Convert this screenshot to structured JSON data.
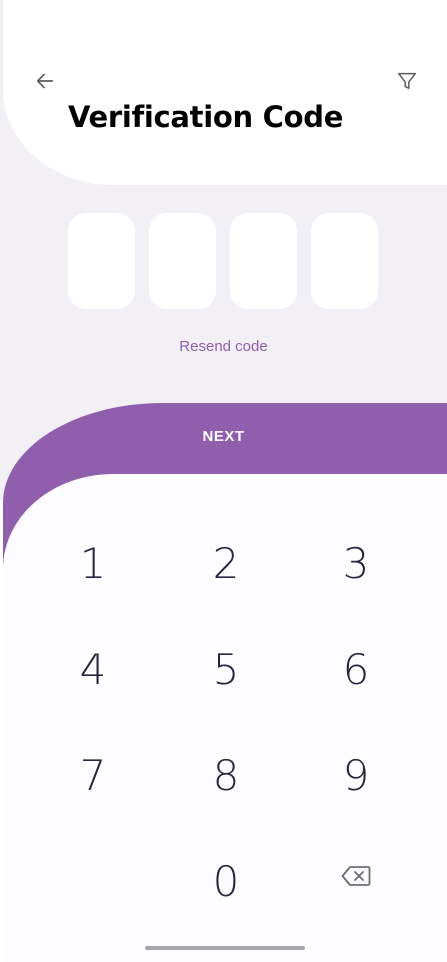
{
  "header": {
    "title": "Verification Code",
    "back_icon": "arrow-left-icon",
    "filter_icon": "funnel-filter-icon"
  },
  "otp": {
    "digits": [
      "",
      "",
      "",
      ""
    ]
  },
  "resend_label": "Resend code",
  "next_label": "NEXT",
  "keypad": {
    "keys": [
      "1",
      "2",
      "3",
      "4",
      "5",
      "6",
      "7",
      "8",
      "9",
      "0"
    ],
    "backspace_icon": "backspace-icon"
  },
  "colors": {
    "accent": "#8f5fae",
    "background_tint": "#f2eff5",
    "key_text": "#2b2440"
  }
}
